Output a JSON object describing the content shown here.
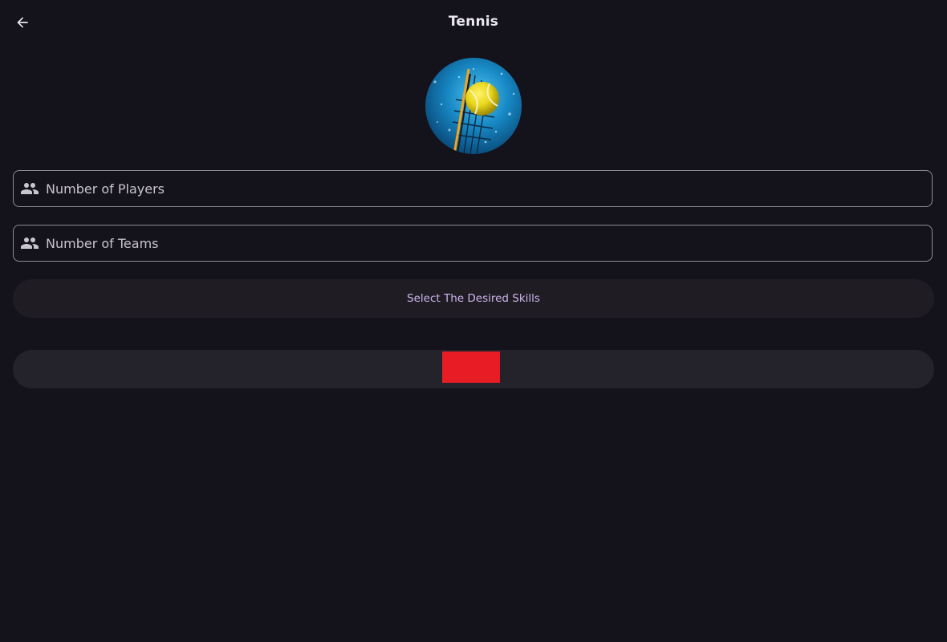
{
  "app_bar": {
    "title": "Tennis",
    "back_icon": "arrow-back-icon"
  },
  "sport_image": {
    "alt": "Tennis"
  },
  "fields": {
    "players": {
      "placeholder": "Number of Players",
      "value": "",
      "icon": "people-icon"
    },
    "teams": {
      "placeholder": "Number of Teams",
      "value": "",
      "icon": "people-icon"
    }
  },
  "skills_button": {
    "label": "Select The Desired Skills"
  },
  "colors": {
    "background": "#14121a",
    "skills_label": "#cdb4ee",
    "field_border": "#8f8b96",
    "red_block": "#e81c25"
  }
}
